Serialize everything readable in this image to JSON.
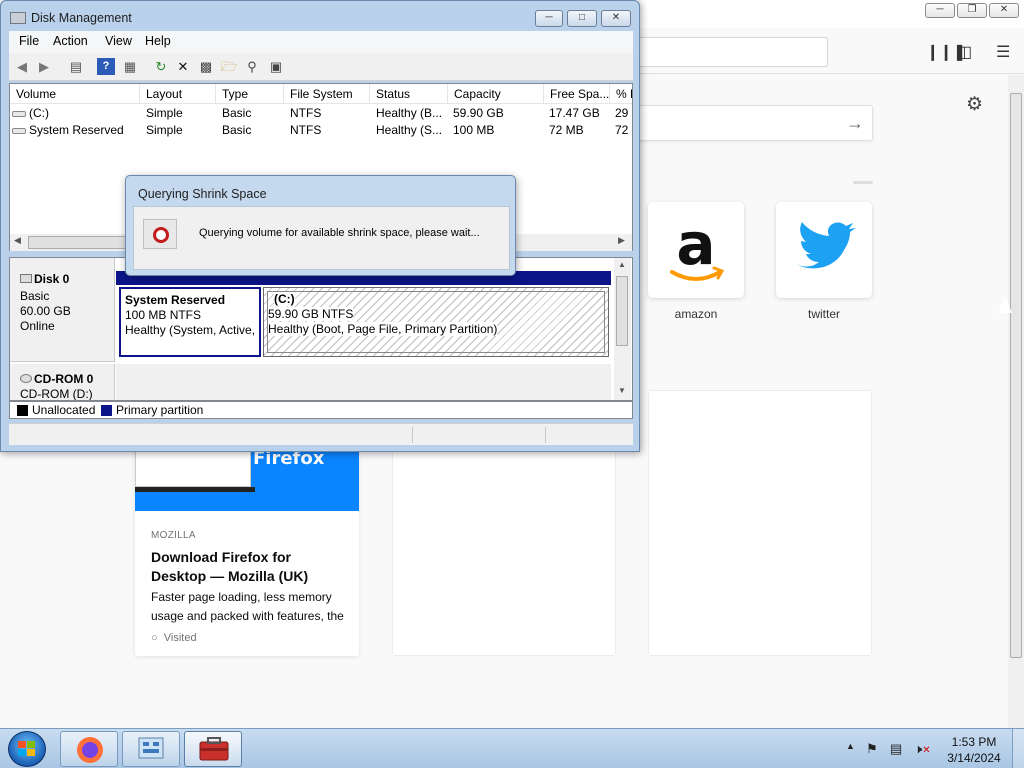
{
  "firefox": {
    "tiles": [
      {
        "label": "amazon"
      },
      {
        "label": "twitter"
      }
    ],
    "card": {
      "logo": "Firefox",
      "source": "MOZILLA",
      "title": "Download Firefox for Desktop — Mozilla (UK)",
      "description": "Faster page loading, less memory usage and packed with features, the",
      "status": "Visited"
    }
  },
  "disk_management": {
    "title": "Disk Management",
    "menu": [
      "File",
      "Action",
      "View",
      "Help"
    ],
    "columns": [
      "Volume",
      "Layout",
      "Type",
      "File System",
      "Status",
      "Capacity",
      "Free Spa...",
      "% F"
    ],
    "volumes": [
      {
        "volume": "(C:)",
        "layout": "Simple",
        "type": "Basic",
        "fs": "NTFS",
        "status": "Healthy (B...",
        "capacity": "59.90 GB",
        "free": "17.47 GB",
        "pct": "29"
      },
      {
        "volume": "System Reserved",
        "layout": "Simple",
        "type": "Basic",
        "fs": "NTFS",
        "status": "Healthy (S...",
        "capacity": "100 MB",
        "free": "72 MB",
        "pct": "72"
      }
    ],
    "disk0": {
      "name": "Disk 0",
      "type": "Basic",
      "size": "60.00 GB",
      "state": "Online",
      "partitions": [
        {
          "name": "System Reserved",
          "size": "100 MB NTFS",
          "status": "Healthy (System, Active,"
        },
        {
          "name": "(C:)",
          "size": "59.90 GB NTFS",
          "status": "Healthy (Boot, Page File, Primary Partition)"
        }
      ]
    },
    "cdrom": {
      "name": "CD-ROM 0",
      "drive": "CD-ROM (D:)"
    },
    "legend": [
      {
        "label": "Unallocated",
        "color": "#000000"
      },
      {
        "label": "Primary partition",
        "color": "#0b1589"
      }
    ]
  },
  "dialog": {
    "title": "Querying Shrink Space",
    "message": "Querying volume for available shrink space, please wait..."
  },
  "taskbar": {
    "time": "1:53 PM",
    "date": "3/14/2024"
  }
}
